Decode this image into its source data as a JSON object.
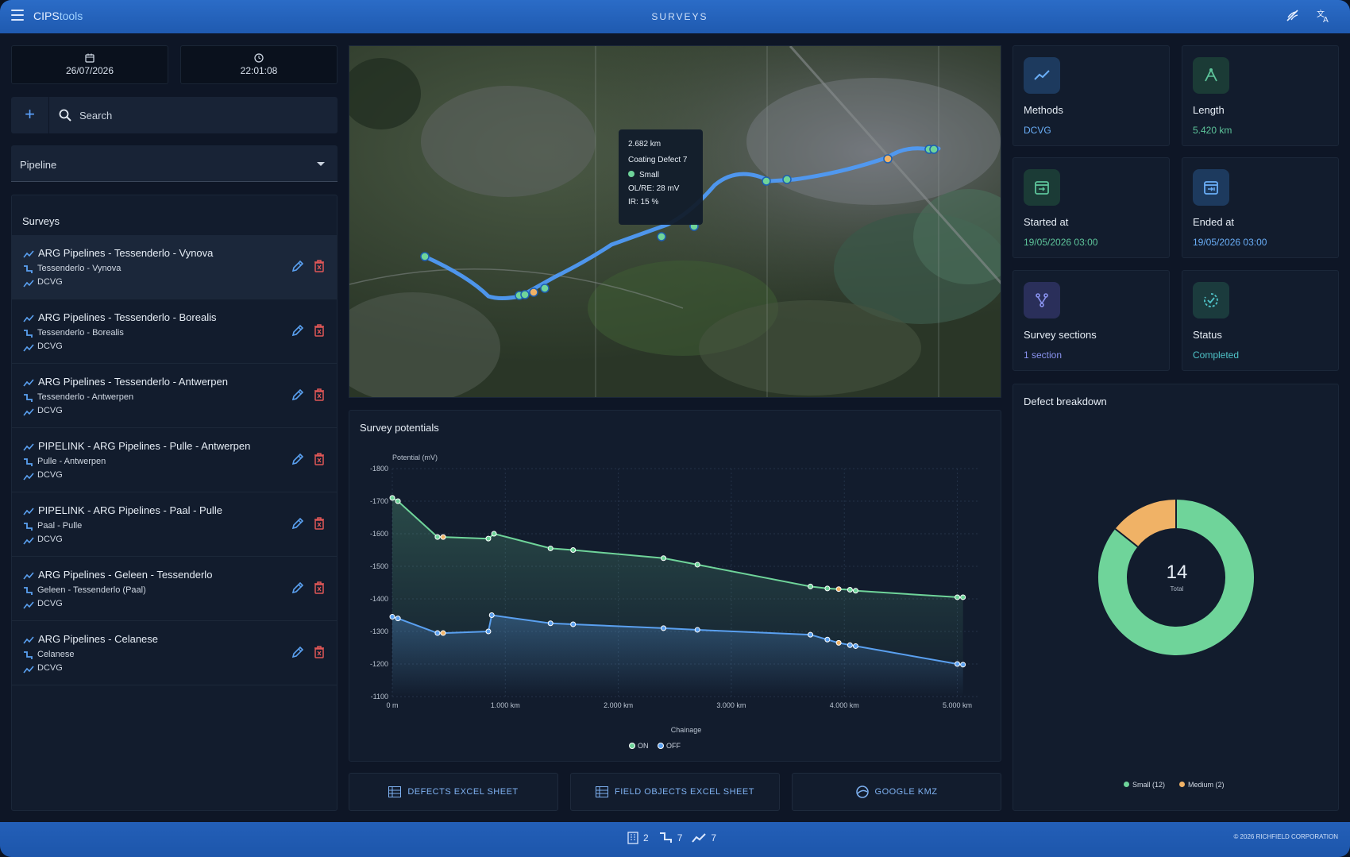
{
  "header": {
    "logo_a": "CIPS",
    "logo_b": "tools",
    "title": "SURVEYS"
  },
  "datetime": {
    "date": "26/07/2026",
    "time": "22:01:08"
  },
  "search": {
    "placeholder": "Search"
  },
  "pipeline_select": {
    "value": "Pipeline"
  },
  "surveys_panel": {
    "title": "Surveys",
    "items": [
      {
        "name": "ARG Pipelines - Tessenderlo - Vynova",
        "route": "Tessenderlo - Vynova",
        "method": "DCVG"
      },
      {
        "name": "ARG Pipelines - Tessenderlo - Borealis",
        "route": "Tessenderlo - Borealis",
        "method": "DCVG"
      },
      {
        "name": "ARG Pipelines - Tessenderlo - Antwerpen",
        "route": "Tessenderlo - Antwerpen",
        "method": "DCVG"
      },
      {
        "name": "PIPELINK - ARG Pipelines - Pulle - Antwerpen",
        "route": "Pulle - Antwerpen",
        "method": "DCVG"
      },
      {
        "name": "PIPELINK - ARG Pipelines - Paal - Pulle",
        "route": "Paal - Pulle",
        "method": "DCVG"
      },
      {
        "name": "ARG Pipelines - Geleen - Tessenderlo",
        "route": "Geleen - Tessenderlo (Paal)",
        "method": "DCVG"
      },
      {
        "name": "ARG Pipelines - Celanese",
        "route": "Celanese",
        "method": "DCVG"
      }
    ]
  },
  "map_tooltip": {
    "distance": "2.682 km",
    "defect": "Coating Defect 7",
    "size": "Small",
    "olre": "OL/RE: 28 mV",
    "ir": "IR: 15 %"
  },
  "chart_title": "Survey potentials",
  "chart_data": {
    "type": "line",
    "ylabel": "Potential (mV)",
    "xlabel": "Chainage",
    "y_ticks": [
      "-1800",
      "-1700",
      "-1600",
      "-1500",
      "-1400",
      "-1300",
      "-1200",
      "-1100"
    ],
    "x_ticks": [
      "0 m",
      "1.000 km",
      "2.000 km",
      "3.000 km",
      "4.000 km",
      "5.000 km"
    ],
    "xlim": [
      0,
      5.2
    ],
    "ylim": [
      -1800,
      -1100
    ],
    "legend": [
      "ON",
      "OFF"
    ],
    "series": [
      {
        "name": "ON",
        "color": "#6fd49a",
        "x": [
          0,
          0.05,
          0.4,
          0.45,
          0.85,
          0.9,
          1.4,
          1.6,
          2.4,
          2.7,
          3.7,
          3.85,
          3.95,
          4.05,
          4.1,
          5.0,
          5.05
        ],
        "y": [
          -1710,
          -1700,
          -1590,
          -1590,
          -1585,
          -1600,
          -1555,
          -1550,
          -1525,
          -1505,
          -1438,
          -1432,
          -1430,
          -1428,
          -1425,
          -1405,
          -1405
        ]
      },
      {
        "name": "OFF",
        "color": "#5aa0f0",
        "x": [
          0,
          0.05,
          0.4,
          0.45,
          0.85,
          0.88,
          1.4,
          1.6,
          2.4,
          2.7,
          3.7,
          3.85,
          3.95,
          4.05,
          4.1,
          5.0,
          5.05
        ],
        "y": [
          -1345,
          -1340,
          -1295,
          -1295,
          -1300,
          -1350,
          -1325,
          -1322,
          -1310,
          -1305,
          -1290,
          -1275,
          -1265,
          -1258,
          -1255,
          -1200,
          -1198
        ]
      }
    ]
  },
  "buttons": {
    "defects": "DEFECTS EXCEL SHEET",
    "field_objects": "FIELD OBJECTS EXCEL SHEET",
    "kmz": "GOOGLE KMZ"
  },
  "stats": {
    "methods": {
      "label": "Methods",
      "value": "DCVG"
    },
    "length": {
      "label": "Length",
      "value": "5.420 km"
    },
    "started": {
      "label": "Started at",
      "value": "19/05/2026 03:00"
    },
    "ended": {
      "label": "Ended at",
      "value": "19/05/2026 03:00"
    },
    "sections": {
      "label": "Survey sections",
      "value": "1 section"
    },
    "status": {
      "label": "Status",
      "value": "Completed"
    }
  },
  "defect_breakdown": {
    "title": "Defect breakdown",
    "total": "14",
    "total_label": "Total",
    "slices": [
      {
        "label": "Small (12)",
        "value": 12,
        "color": "#6fd49a"
      },
      {
        "label": "Medium (2)",
        "value": 2,
        "color": "#f0b266"
      }
    ]
  },
  "footer": {
    "count_a": "2",
    "count_b": "7",
    "count_c": "7",
    "copyright": "© 2026 RICHFIELD CORPORATION"
  }
}
